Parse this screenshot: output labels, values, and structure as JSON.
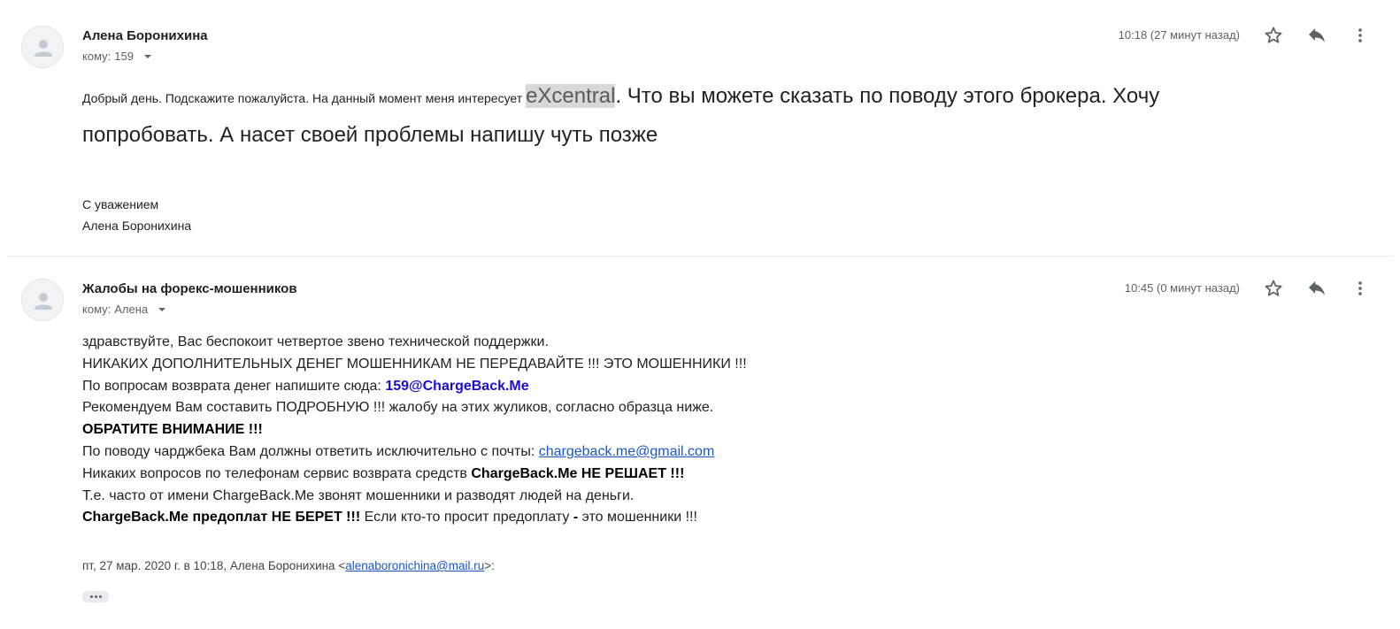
{
  "messages": [
    {
      "sender": "Алена Боронихина",
      "recipient_prefix": "кому:",
      "recipient": "159",
      "time": "10:18 (27 минут назад)",
      "body_small": "Добрый день. Подскажите пожалуйста. На данный момент меня интересует ",
      "body_highlight": "eXcentral",
      "body_rest": ". Что вы можете сказать по поводу этого брокера. Хочу",
      "body_line2": "попробовать. А насет своей проблемы напишу чуть позже",
      "signature_line1": "С уважением",
      "signature_line2": "Алена Боронихина"
    },
    {
      "sender": "Жалобы на форекс-мошенников",
      "recipient_prefix": "кому:",
      "recipient": "Алена",
      "time": "10:45 (0 минут назад)",
      "line1": "здравствуйте, Вас беспокоит четвертое звено технической поддержки.",
      "line2": "НИКАКИХ ДОПОЛНИТЕЛЬНЫХ ДЕНЕГ МОШЕННИКАМ НЕ ПЕРЕДАВАЙТЕ !!! ЭТО МОШЕННИКИ !!!",
      "line3_text": "По вопросам возврата денег напишите сюда: ",
      "line3_email": "159@ChargeBack.Me",
      "line4": "Рекомендуем Вам составить ПОДРОБНУЮ !!! жалобу на этих жуликов, согласно образца ниже.",
      "line5": "ОБРАТИТЕ ВНИМАНИЕ !!!",
      "line6_text": "По поводу чарджбека Вам должны ответить исключительно с почты: ",
      "line6_link": "chargeback.me@gmail.com",
      "line7_text": "Никаких вопросов по телефонам сервис возврата средств ",
      "line7_bold": "ChargeBack.Me НЕ РЕШАЕТ !!!",
      "line8": "Т.е. часто от имени ChargeBack.Me звонят мошенники и разводят людей на деньги.",
      "line9_bold": "ChargeBack.Me предоплат НЕ БЕРЕТ !!!",
      "line9_text": " Если кто-то просит предоплату ",
      "line9_dash": "-",
      "line9_end": " это мошенники !!!",
      "quote_prefix": "пт, 27 мар. 2020 г. в 10:18, Алена Боронихина <",
      "quote_email": "alenaboronichina@mail.ru",
      "quote_suffix": ">:"
    }
  ],
  "icons": [
    "avatar-icon",
    "star-icon",
    "reply-icon",
    "more-vert-icon",
    "chevron-down-icon",
    "show-trimmed-content"
  ],
  "colors": {
    "link": "#1a57c7",
    "email_bold_blue": "#1a0dcf",
    "highlight": "#d8d8d8",
    "icon": "#5f6368"
  }
}
